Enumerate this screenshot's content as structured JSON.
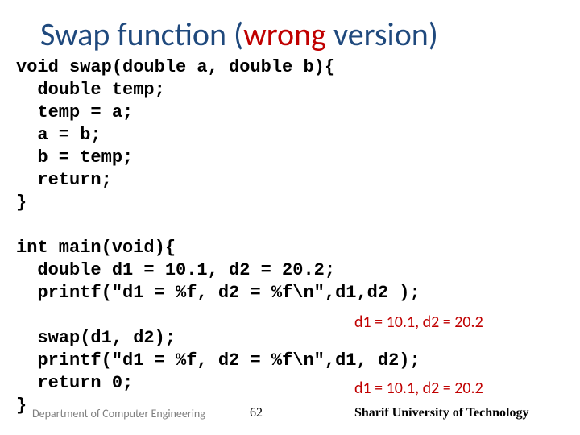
{
  "title": {
    "pre": "Swap function (",
    "wrong": "wrong",
    "post": " version)"
  },
  "code": "void swap(double a, double b){\n  double temp;\n  temp = a;\n  a = b;\n  b = temp;\n  return;\n}\n\nint main(void){\n  double d1 = 10.1, d2 = 20.2;\n  printf(\"d1 = %f, d2 = %f\\n\",d1,d2 );\n\n  swap(d1, d2);\n  printf(\"d1 = %f, d2 = %f\\n\",d1, d2);\n  return 0;\n}",
  "outputs": {
    "first": "d1 = 10.1, d2 = 20.2",
    "second": "d1 = 10.1, d2 = 20.2"
  },
  "footer": {
    "left": "Department of Computer Engineering",
    "page": "62",
    "right": "Sharif University of Technology"
  }
}
